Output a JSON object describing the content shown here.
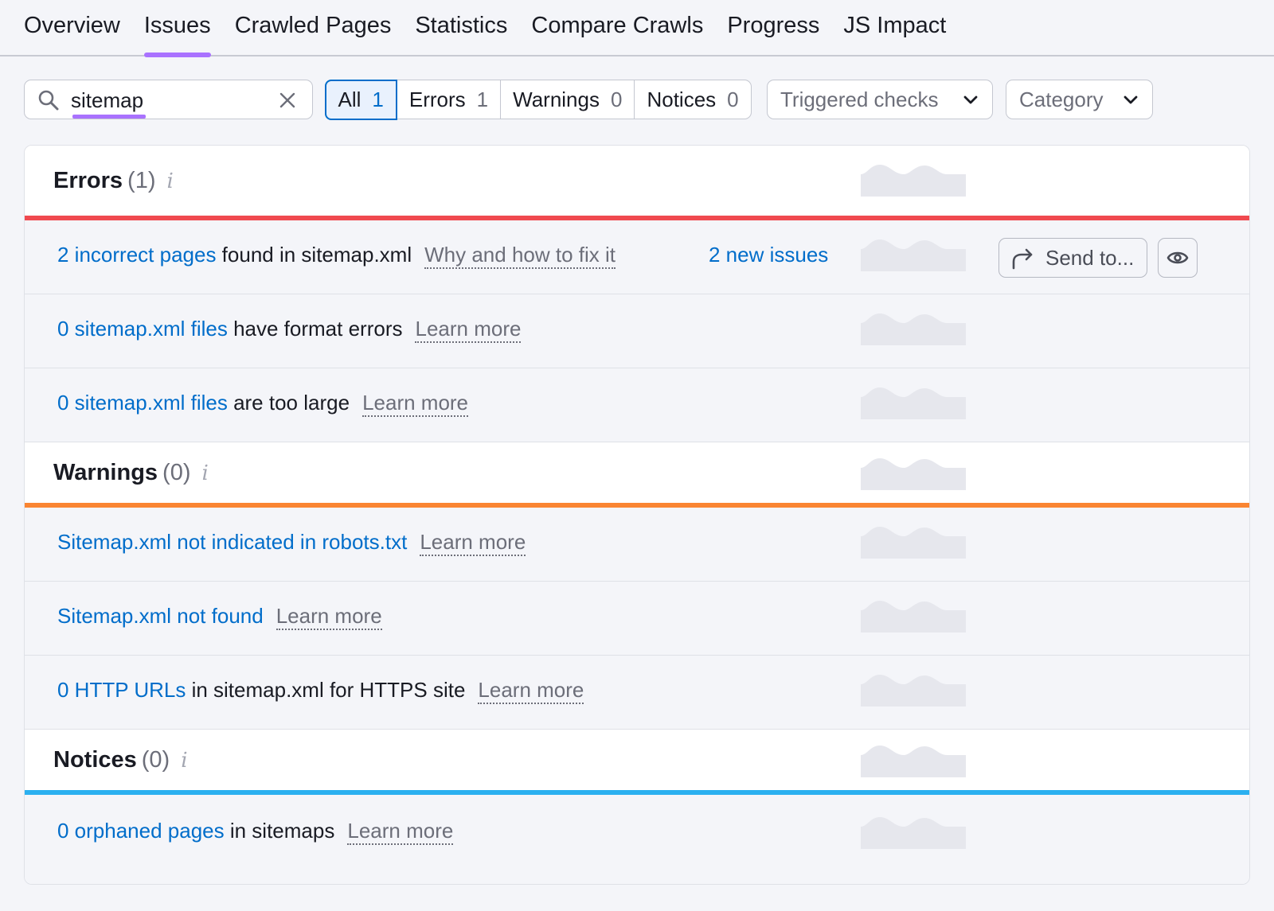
{
  "nav": {
    "tabs": [
      {
        "label": "Overview"
      },
      {
        "label": "Issues"
      },
      {
        "label": "Crawled Pages"
      },
      {
        "label": "Statistics"
      },
      {
        "label": "Compare Crawls"
      },
      {
        "label": "Progress"
      },
      {
        "label": "JS Impact"
      }
    ],
    "active_tab": "Issues"
  },
  "filters": {
    "search_value": "sitemap",
    "segments": [
      {
        "label": "All",
        "count": "1"
      },
      {
        "label": "Errors",
        "count": "1"
      },
      {
        "label": "Warnings",
        "count": "0"
      },
      {
        "label": "Notices",
        "count": "0"
      }
    ],
    "triggered_checks": "Triggered checks",
    "category": "Category"
  },
  "colors": {
    "errors": "#f0494f",
    "warnings": "#fa8532",
    "notices": "#2bb0f0",
    "link": "#006dca",
    "accent": "#a972ff"
  },
  "sections": {
    "errors": {
      "title": "Errors",
      "count": "(1)",
      "rows": [
        {
          "link": "2 incorrect pages",
          "text": " found in sitemap.xml",
          "help": "Why and how to fix it",
          "new_issues": "2 new issues",
          "send_label": "Send to..."
        },
        {
          "link": "0 sitemap.xml files",
          "text": " have format errors",
          "help": "Learn more"
        },
        {
          "link": "0 sitemap.xml files",
          "text": " are too large",
          "help": "Learn more"
        }
      ]
    },
    "warnings": {
      "title": "Warnings",
      "count": "(0)",
      "rows": [
        {
          "link": "Sitemap.xml not indicated in robots.txt",
          "text": "",
          "help": "Learn more"
        },
        {
          "link": "Sitemap.xml not found",
          "text": "",
          "help": "Learn more"
        },
        {
          "link": "0 HTTP URLs",
          "text": " in sitemap.xml for HTTPS site",
          "help": "Learn more"
        }
      ]
    },
    "notices": {
      "title": "Notices",
      "count": "(0)",
      "rows": [
        {
          "link": "0 orphaned pages",
          "text": " in sitemaps",
          "help": "Learn more"
        }
      ]
    }
  }
}
